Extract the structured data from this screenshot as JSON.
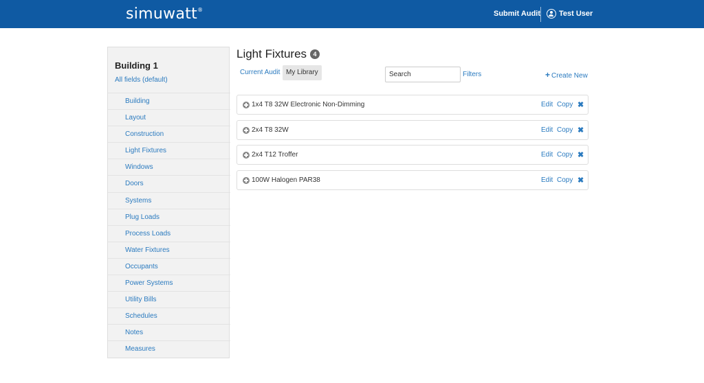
{
  "header": {
    "logo": "simuwatt",
    "logo_mark": "®",
    "submit_audit": "Submit Audit",
    "user_name": "Test User"
  },
  "sidebar": {
    "title": "Building 1",
    "subtitle": "All fields (default)",
    "items": [
      {
        "label": "Building"
      },
      {
        "label": "Layout"
      },
      {
        "label": "Construction"
      },
      {
        "label": "Light Fixtures"
      },
      {
        "label": "Windows"
      },
      {
        "label": "Doors"
      },
      {
        "label": "Systems"
      },
      {
        "label": "Plug Loads"
      },
      {
        "label": "Process Loads"
      },
      {
        "label": "Water Fixtures"
      },
      {
        "label": "Occupants"
      },
      {
        "label": "Power Systems"
      },
      {
        "label": "Utility Bills"
      },
      {
        "label": "Schedules"
      },
      {
        "label": "Notes"
      },
      {
        "label": "Measures"
      }
    ]
  },
  "main": {
    "title": "Light Fixtures",
    "count": "4",
    "tabs": [
      {
        "label": "Current Audit",
        "active": false
      },
      {
        "label": "My Library",
        "active": true
      }
    ],
    "search_placeholder": "Search",
    "filters_label": "Filters",
    "create_new_label": "Create New",
    "create_new_icon": "plus-icon",
    "rows": [
      {
        "name": "1x4 T8 32W Electronic Non-Dimming",
        "edit": "Edit",
        "copy": "Copy",
        "delete_icon": "close-icon"
      },
      {
        "name": "2x4 T8 32W",
        "edit": "Edit",
        "copy": "Copy",
        "delete_icon": "close-icon"
      },
      {
        "name": "2x4 T12 Troffer",
        "edit": "Edit",
        "copy": "Copy",
        "delete_icon": "close-icon"
      },
      {
        "name": "100W Halogen PAR38",
        "edit": "Edit",
        "copy": "Copy",
        "delete_icon": "close-icon"
      }
    ]
  },
  "colors": {
    "brand_blue": "#0f5aa3",
    "link_blue": "#2a7abf",
    "sidebar_bg": "#f2f2f2"
  }
}
